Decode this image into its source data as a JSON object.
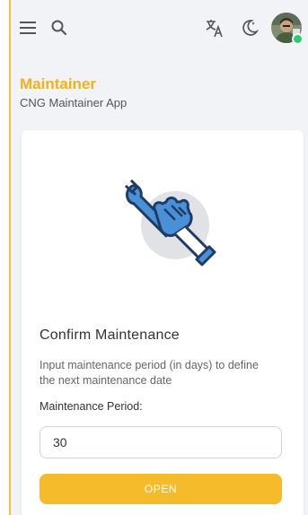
{
  "header": {
    "icons": [
      "menu-icon",
      "search-icon",
      "translate-icon",
      "theme-toggle-icon",
      "avatar"
    ],
    "status_color": "#2ecc71"
  },
  "page": {
    "title": "Maintainer",
    "subtitle": "CNG Maintainer App",
    "accent_color": "#f2b11b"
  },
  "card": {
    "illustration": "wrench-in-hand-icon",
    "title": "Confirm Maintenance",
    "description": "Input maintenance period (in days) to define the next maintenance date",
    "field_label": "Maintenance Period:",
    "field_value": "30",
    "button_label": "OPEN",
    "button_color": "#f5bb2a"
  }
}
